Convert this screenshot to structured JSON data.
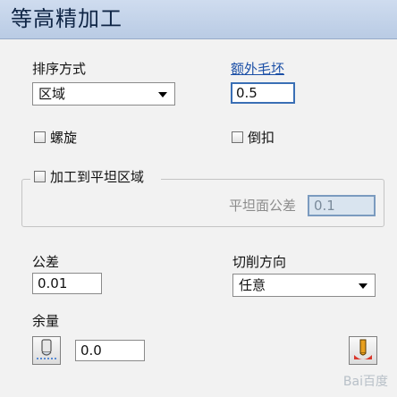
{
  "header": {
    "title": "等高精加工"
  },
  "ordering": {
    "label": "排序方式",
    "value": "区域"
  },
  "extra_stock": {
    "label": "额外毛坯",
    "value": "0.5"
  },
  "spiral": {
    "label": "螺旋",
    "checked": false
  },
  "undercut": {
    "label": "倒扣",
    "checked": false
  },
  "flat_areas": {
    "label": "加工到平坦区域",
    "checked": false,
    "tolerance_label": "平坦面公差",
    "tolerance_value": "0.1"
  },
  "tolerance": {
    "label": "公差",
    "value": "0.01"
  },
  "cut_direction": {
    "label": "切削方向",
    "value": "任意"
  },
  "thickness": {
    "label": "余量",
    "value": "0.0"
  },
  "watermark": {
    "text": "Bai百度"
  }
}
